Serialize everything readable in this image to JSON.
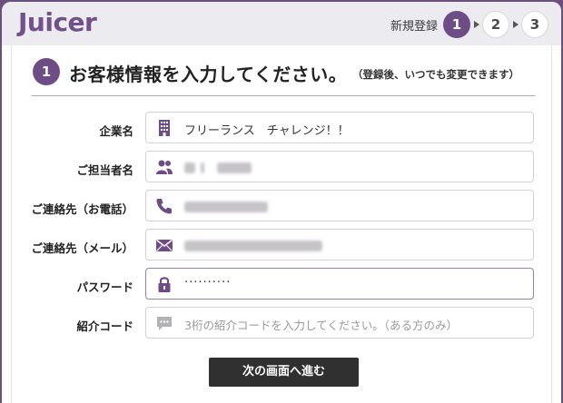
{
  "header": {
    "logo": "Juicer",
    "step_label": "新規登録",
    "steps": [
      "1",
      "2",
      "3"
    ],
    "accent_color": "#6e4c86"
  },
  "form": {
    "step_number": "1",
    "title": "お客様情報を入力してください。",
    "title_note": "（登録後、いつでも変更できます）",
    "fields": [
      {
        "label": "企業名",
        "icon": "building-icon",
        "value": "フリーランス　チャレンジ！！"
      },
      {
        "label": "ご担当者名",
        "icon": "people-icon",
        "value": "",
        "redacted": true
      },
      {
        "label": "ご連絡先（お電話）",
        "icon": "phone-icon",
        "value": "",
        "redacted": true
      },
      {
        "label": "ご連絡先（メール）",
        "icon": "mail-icon",
        "value": "",
        "redacted": true
      },
      {
        "label": "パスワード",
        "icon": "lock-icon",
        "value": "··········"
      },
      {
        "label": "紹介コード",
        "icon": "chat-icon",
        "value": "",
        "placeholder": "3桁の紹介コードを入力してください。（ある方のみ）"
      }
    ],
    "submit_label": "次の画面へ進む"
  }
}
